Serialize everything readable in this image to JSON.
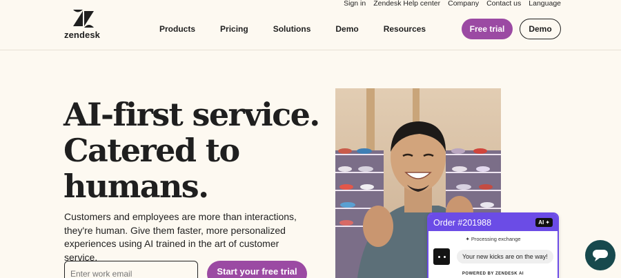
{
  "utility_nav": [
    "Sign in",
    "Zendesk Help center",
    "Company",
    "Contact us",
    "Language"
  ],
  "logo": {
    "wordmark": "zendesk",
    "icon": "zendesk-z-icon"
  },
  "main_nav": [
    "Products",
    "Pricing",
    "Solutions",
    "Demo",
    "Resources"
  ],
  "header_buttons": {
    "free_trial": "Free trial",
    "demo": "Demo"
  },
  "hero": {
    "title_lines": [
      "AI-first service.",
      "Catered to",
      "humans."
    ],
    "body": "Customers and employees are more than interactions, they're human. Give them faster, more personalized experiences using AI trained in the art of customer service.",
    "email_placeholder": "Enter work email",
    "cta": "Start your free trial"
  },
  "order_card": {
    "title": "Order #201988",
    "badge": "AI",
    "status": "Processing exchange",
    "message": "Your new kicks are on the way!",
    "footer": "POWERED BY ZENDESK AI"
  },
  "chat_launcher": {
    "icon": "chat-bubble-icon"
  },
  "colors": {
    "background": "#fdf9f1",
    "brand_purple": "#9b4aa3",
    "card_purple": "#6b4ce6",
    "chat_teal": "#17494d"
  }
}
